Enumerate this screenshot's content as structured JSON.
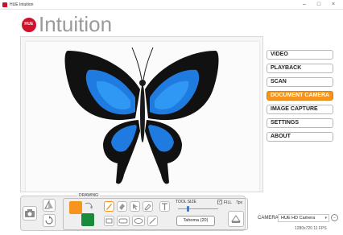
{
  "window": {
    "title": "HUE Intuition",
    "minimize": "–",
    "maximize": "□",
    "close": "×"
  },
  "header": {
    "logo_badge": "HUE",
    "logo_text": "Intuition"
  },
  "menu": {
    "items": [
      {
        "label": "VIDEO"
      },
      {
        "label": "PLAYBACK"
      },
      {
        "label": "SCAN"
      },
      {
        "label": "DOCUMENT CAMERA",
        "active": true
      },
      {
        "label": "IMAGE CAPTURE"
      },
      {
        "label": "SETTINGS"
      },
      {
        "label": "ABOUT"
      }
    ]
  },
  "toolbar": {
    "drawing_label": "DRAWING",
    "tool_size_label": "TOOL SIZE",
    "fill_label": "FILL",
    "fill_checked": "✓",
    "size_value": "7px",
    "font_button": "Tahoma (20)",
    "colors": {
      "primary": "#f7941d",
      "secondary": "#1a8a3c"
    }
  },
  "camera": {
    "label": "CAMERA:",
    "selected": "HUE HD Camera",
    "more_button": "...",
    "resolution": "1280x720 11 FPS"
  },
  "colors": {
    "accent": "#f7941d",
    "brand": "#d0112b",
    "butterfly_blue": "#1f7be0"
  }
}
